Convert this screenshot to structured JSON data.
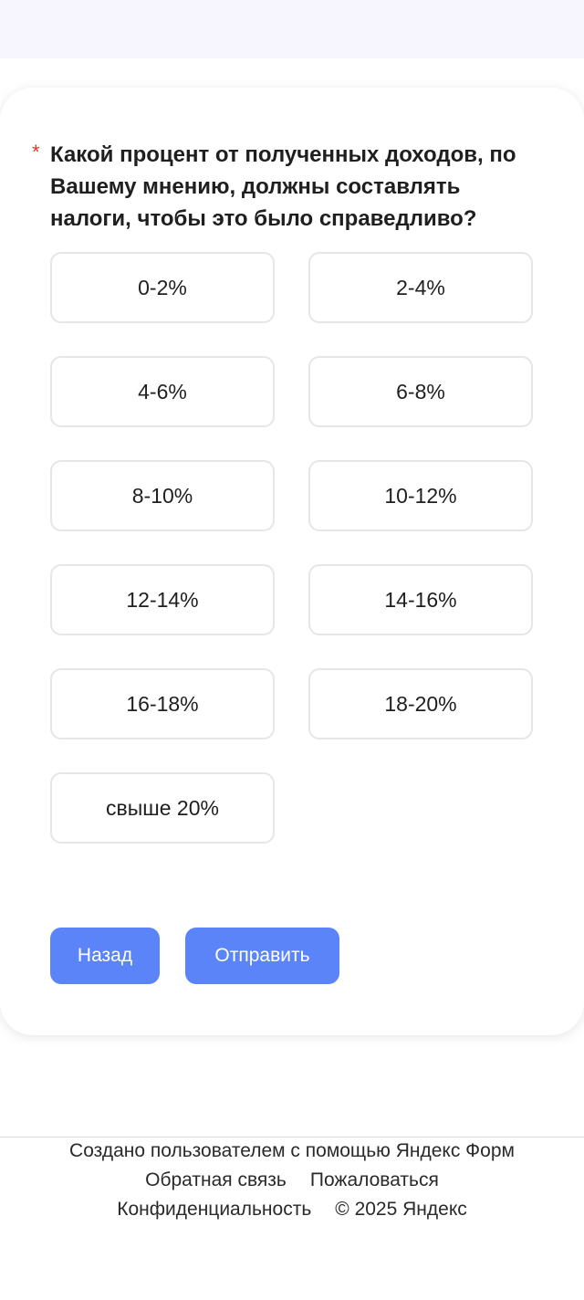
{
  "question": {
    "required_marker": "*",
    "text": "Какой процент от полученных доходов, по Вашему мнению, должны составлять налоги, чтобы это было справедливо?"
  },
  "options": [
    "0-2%",
    "2-4%",
    "4-6%",
    "6-8%",
    "8-10%",
    "10-12%",
    "12-14%",
    "14-16%",
    "16-18%",
    "18-20%",
    "свыше 20%"
  ],
  "buttons": {
    "back": "Назад",
    "submit": "Отправить"
  },
  "footer": {
    "created_by": "Создано пользователем с помощью Яндекс Форм",
    "feedback": "Обратная связь",
    "complain": "Пожаловаться",
    "privacy": "Конфиденциальность",
    "copyright": "© 2025 Яндекс"
  },
  "colors": {
    "button_bg": "#5b84f8",
    "required_marker": "#e0352b",
    "top_bar": "#f7f5fd"
  }
}
